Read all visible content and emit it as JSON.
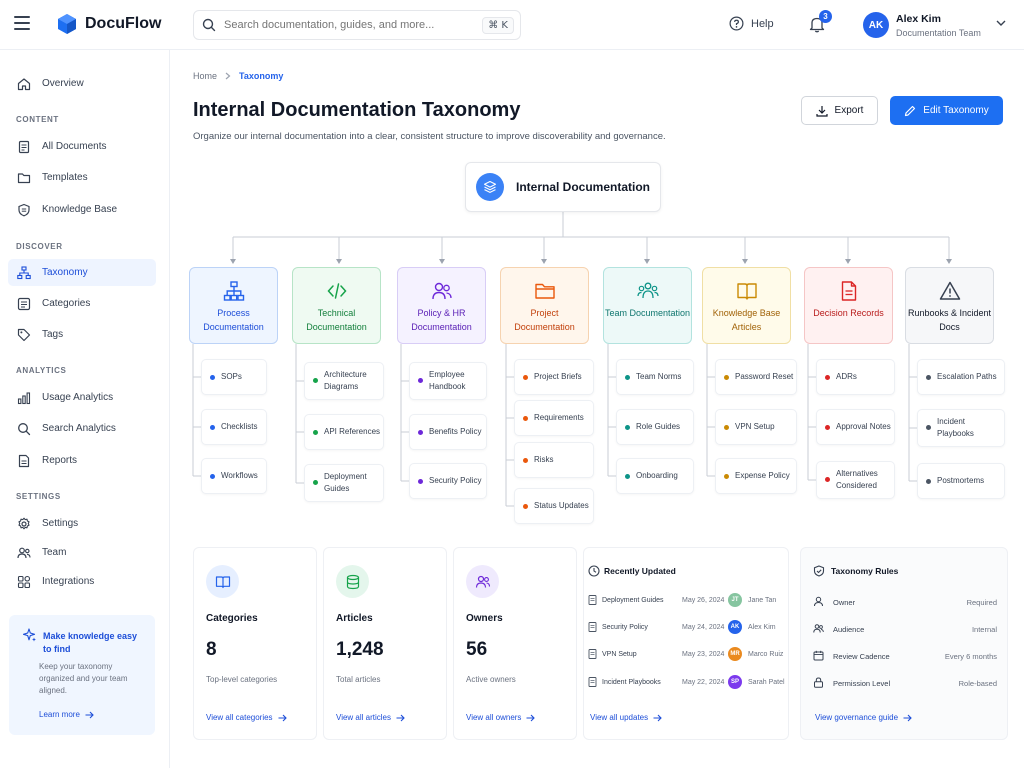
{
  "app": {
    "name": "DocuFlow"
  },
  "search": {
    "placeholder": "Search documentation, guides, and more...",
    "shortcut": "⌘ K"
  },
  "header": {
    "help_label": "Help",
    "notification_count": "3"
  },
  "user": {
    "initials": "AK",
    "name": "Alex Kim",
    "team": "Documentation Team"
  },
  "sidebar": {
    "overview": "Overview",
    "sections": {
      "content": "CONTENT",
      "discover": "DISCOVER",
      "analytics": "ANALYTICS",
      "settings": "SETTINGS"
    },
    "content_items": [
      "All Documents",
      "Templates",
      "Knowledge Base"
    ],
    "discover_items": [
      "Taxonomy",
      "Categories",
      "Tags"
    ],
    "analytics_items": [
      "Usage Analytics",
      "Search Analytics",
      "Reports"
    ],
    "settings_items": [
      "Settings",
      "Team",
      "Integrations"
    ],
    "promo": {
      "title": "Make knowledge easy to find",
      "desc": "Keep your taxonomy organized and your team aligned.",
      "link": "Learn more"
    }
  },
  "breadcrumb": {
    "home": "Home",
    "current": "Taxonomy"
  },
  "page": {
    "title": "Internal Documentation Taxonomy",
    "subtitle": "Organize our internal documentation into a clear, consistent structure to improve discoverability and governance.",
    "export_label": "Export",
    "edit_label": "Edit Taxonomy"
  },
  "tree": {
    "root": "Internal Documentation",
    "categories": [
      {
        "label": "Process Documentation",
        "color": "#2563eb",
        "children": [
          "SOPs",
          "Checklists",
          "Workflows"
        ]
      },
      {
        "label": "Technical Documentation",
        "color": "#16a34a",
        "children": [
          "Architecture Diagrams",
          "API References",
          "Deployment Guides"
        ]
      },
      {
        "label": "Policy & HR Documentation",
        "color": "#6d28d9",
        "children": [
          "Employee Handbook",
          "Benefits Policy",
          "Security Policy"
        ]
      },
      {
        "label": "Project Documentation",
        "color": "#ea580c",
        "children": [
          "Project Briefs",
          "Requirements",
          "Risks",
          "Status Updates"
        ]
      },
      {
        "label": "Team Documentation",
        "color": "#0d9488",
        "children": [
          "Team Norms",
          "Role Guides",
          "Onboarding"
        ]
      },
      {
        "label": "Knowledge Base Articles",
        "color": "#ca8a04",
        "children": [
          "Password Reset",
          "VPN Setup",
          "Expense Policy"
        ]
      },
      {
        "label": "Decision Records",
        "color": "#dc2626",
        "children": [
          "ADRs",
          "Approval Notes",
          "Alternatives Considered"
        ]
      },
      {
        "label": "Runbooks & Incident Docs",
        "color": "#374151",
        "children": [
          "Escalation Paths",
          "Incident Playbooks",
          "Postmortems"
        ]
      }
    ]
  },
  "stats": [
    {
      "label": "Categories",
      "value": "8",
      "desc": "Top-level categories",
      "link": "View all categories"
    },
    {
      "label": "Articles",
      "value": "1,248",
      "desc": "Total articles",
      "link": "View all articles"
    },
    {
      "label": "Owners",
      "value": "56",
      "desc": "Active owners",
      "link": "View all owners"
    }
  ],
  "recently_updated": {
    "title": "Recently Updated",
    "rows": [
      {
        "name": "Deployment Guides",
        "date": "May 26, 2024",
        "initials": "JT",
        "owner": "Jane Tan",
        "color": "#86c5a0"
      },
      {
        "name": "Security Policy",
        "date": "May 24, 2024",
        "initials": "AK",
        "owner": "Alex Kim",
        "color": "#2563eb"
      },
      {
        "name": "VPN Setup",
        "date": "May 23, 2024",
        "initials": "MR",
        "owner": "Marco Ruiz",
        "color": "#ea8a1f"
      },
      {
        "name": "Incident Playbooks",
        "date": "May 22, 2024",
        "initials": "SP",
        "owner": "Sarah Patel",
        "color": "#7c3aed"
      }
    ],
    "link": "View all updates"
  },
  "rules": {
    "title": "Taxonomy Rules",
    "rows": [
      {
        "key": "Owner",
        "value": "Required"
      },
      {
        "key": "Audience",
        "value": "Internal"
      },
      {
        "key": "Review Cadence",
        "value": "Every 6 months"
      },
      {
        "key": "Permission Level",
        "value": "Role-based"
      }
    ],
    "link": "View governance guide"
  }
}
